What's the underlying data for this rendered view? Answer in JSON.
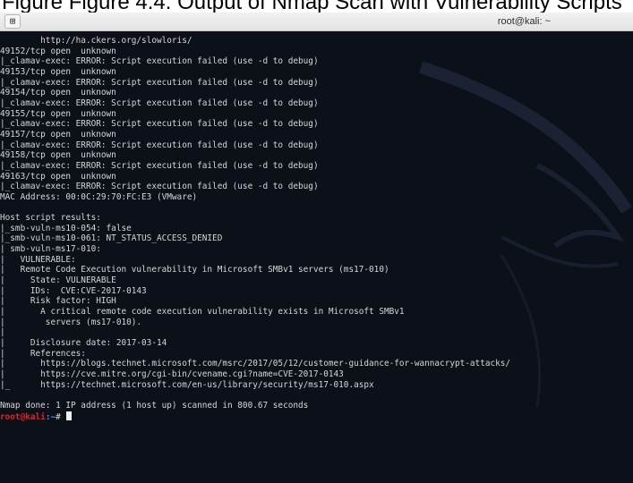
{
  "caption": "Figure  Figure 4.4: Output of Nmap Scan with Vulnerability Scripts",
  "window": {
    "title": "root@kali: ~",
    "menu_button_glyph": "⊞"
  },
  "terminal": {
    "lines": [
      "        http://ha.ckers.org/slowloris/",
      "49152/tcp open  unknown",
      "|_clamav-exec: ERROR: Script execution failed (use -d to debug)",
      "49153/tcp open  unknown",
      "|_clamav-exec: ERROR: Script execution failed (use -d to debug)",
      "49154/tcp open  unknown",
      "|_clamav-exec: ERROR: Script execution failed (use -d to debug)",
      "49155/tcp open  unknown",
      "|_clamav-exec: ERROR: Script execution failed (use -d to debug)",
      "49157/tcp open  unknown",
      "|_clamav-exec: ERROR: Script execution failed (use -d to debug)",
      "49158/tcp open  unknown",
      "|_clamav-exec: ERROR: Script execution failed (use -d to debug)",
      "49163/tcp open  unknown",
      "|_clamav-exec: ERROR: Script execution failed (use -d to debug)",
      "MAC Address: 00:0C:29:70:FC:E3 (VMware)",
      "",
      "Host script results:",
      "|_smb-vuln-ms10-054: false",
      "|_smb-vuln-ms10-061: NT_STATUS_ACCESS_DENIED",
      "| smb-vuln-ms17-010:",
      "|   VULNERABLE:",
      "|   Remote Code Execution vulnerability in Microsoft SMBv1 servers (ms17-010)",
      "|     State: VULNERABLE",
      "|     IDs:  CVE:CVE-2017-0143",
      "|     Risk factor: HIGH",
      "|       A critical remote code execution vulnerability exists in Microsoft SMBv1",
      "|        servers (ms17-010).",
      "|",
      "|     Disclosure date: 2017-03-14",
      "|     References:",
      "|       https://blogs.technet.microsoft.com/msrc/2017/05/12/customer-guidance-for-wannacrypt-attacks/",
      "|       https://cve.mitre.org/cgi-bin/cvename.cgi?name=CVE-2017-0143",
      "|_      https://technet.microsoft.com/en-us/library/security/ms17-010.aspx",
      "",
      "Nmap done: 1 IP address (1 host up) scanned in 800.67 seconds"
    ],
    "prompt": {
      "user_host": "root@kali",
      "path": ":~",
      "symbol": "# "
    }
  },
  "colors": {
    "terminal_bg": "#0c1018",
    "prompt_user": "#e0222a",
    "prompt_path": "#5a8cff"
  }
}
